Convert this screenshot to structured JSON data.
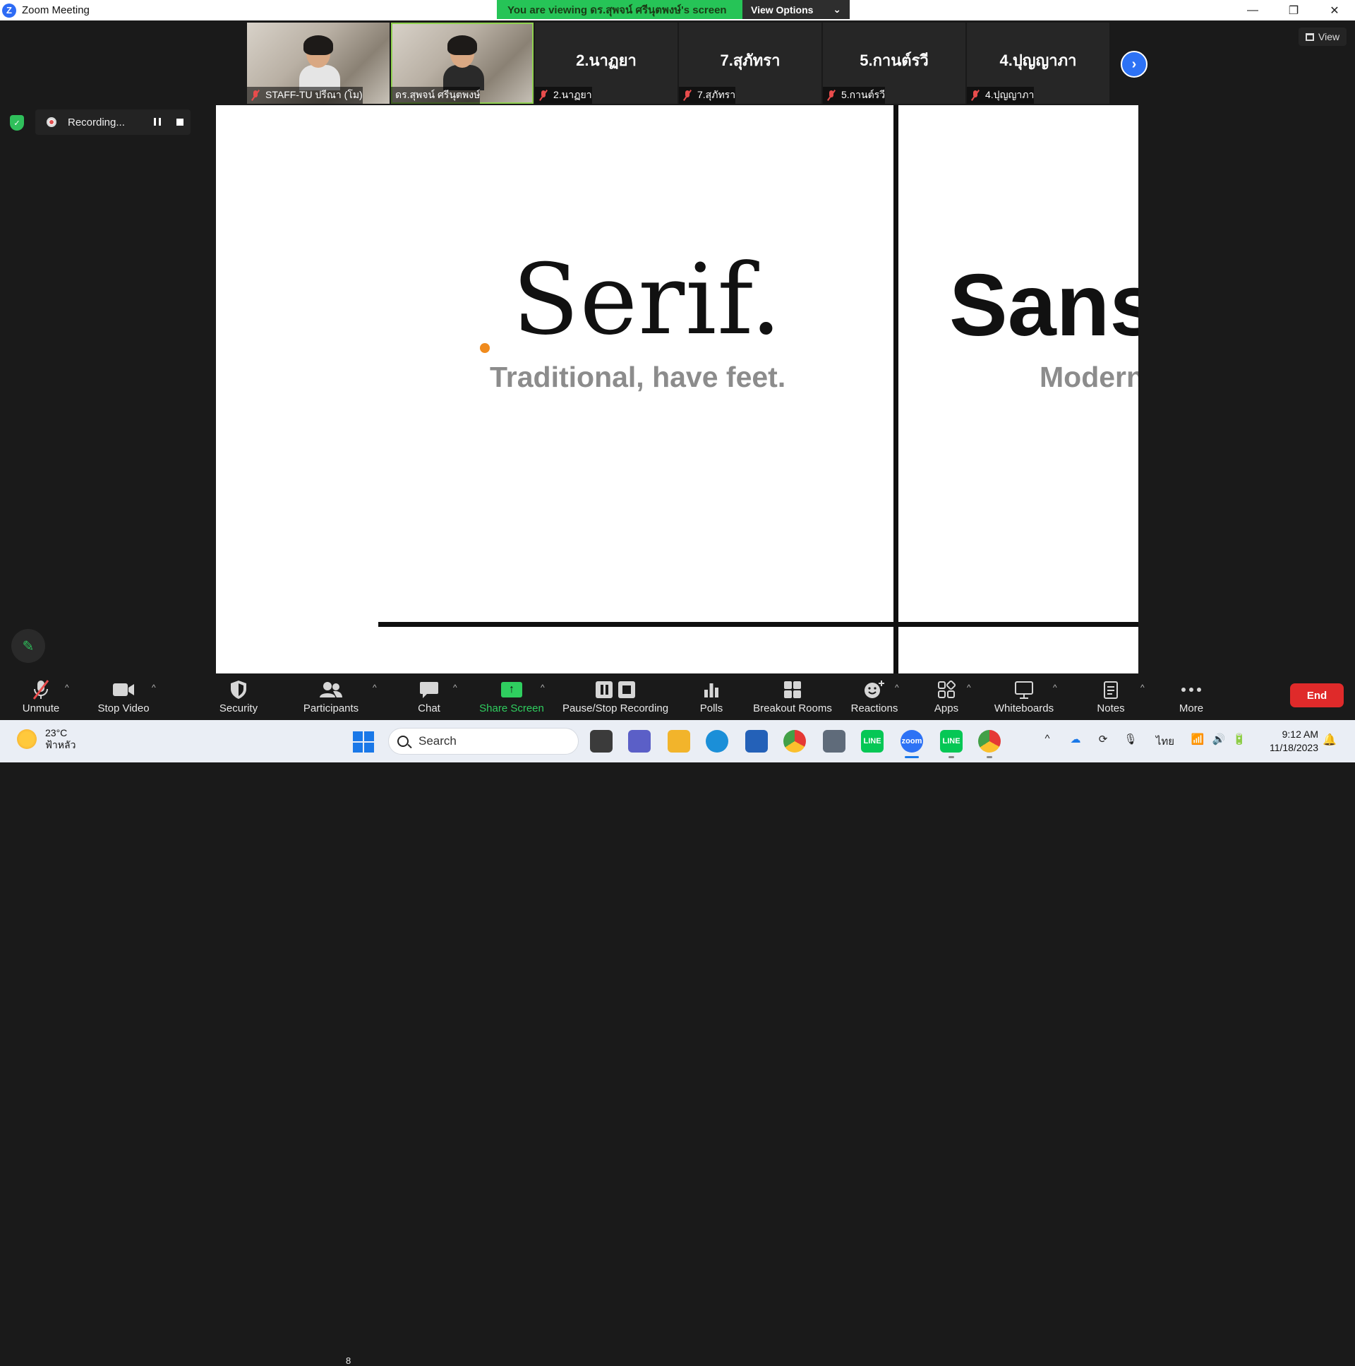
{
  "window": {
    "app_title": "Zoom Meeting",
    "minimize": "—",
    "restore": "❐",
    "close": "✕"
  },
  "banner": {
    "message": "You are viewing ดร.สุพจน์ ศรีนุตพงษ์'s screen",
    "view_options": "View Options",
    "caret": "⌄"
  },
  "participants_strip": [
    {
      "name": "STAFF-TU ปรีณา (โม)",
      "video": true,
      "gender": "f",
      "active": false
    },
    {
      "name": "ดร.สุพจน์ ศรีนุตพงษ์",
      "video": true,
      "gender": "m",
      "active": true
    },
    {
      "name": "2.นาฏยา",
      "big": "2.นาฏยา",
      "video": false
    },
    {
      "name": "7.สุภัทรา",
      "big": "7.สุภัทรา",
      "video": false
    },
    {
      "name": "5.กานต์รวี",
      "big": "5.กานต์รวี",
      "video": false
    },
    {
      "name": "4.ปุญญาภา",
      "big": "4.ปุญญาภา",
      "video": false
    }
  ],
  "strip_next_icon": "›",
  "view_button": "View",
  "recording": {
    "label": "Recording...",
    "shield_icon": "✓"
  },
  "annotate_icon": "✎",
  "shared_slide": {
    "serif_word": "Serif.",
    "serif_sub": "Traditional, have feet.",
    "sans_word": "Sans",
    "sans_sub": "Modern"
  },
  "toolbar": {
    "unmute": "Unmute",
    "stop_video": "Stop Video",
    "security": "Security",
    "participants": "Participants",
    "participants_count": "8",
    "chat": "Chat",
    "share_screen": "Share Screen",
    "pause_stop_recording": "Pause/Stop Recording",
    "polls": "Polls",
    "breakout_rooms": "Breakout Rooms",
    "reactions": "Reactions",
    "apps": "Apps",
    "whiteboards": "Whiteboards",
    "notes": "Notes",
    "more": "More",
    "end": "End",
    "caret": "^"
  },
  "taskbar": {
    "temperature": "23°C",
    "weather": "ฟ้าหลัว",
    "search": "Search",
    "language": "ไทย",
    "time": "9:12 AM",
    "date": "11/18/2023",
    "zoom_label": "zoom",
    "line_label": "LINE"
  }
}
